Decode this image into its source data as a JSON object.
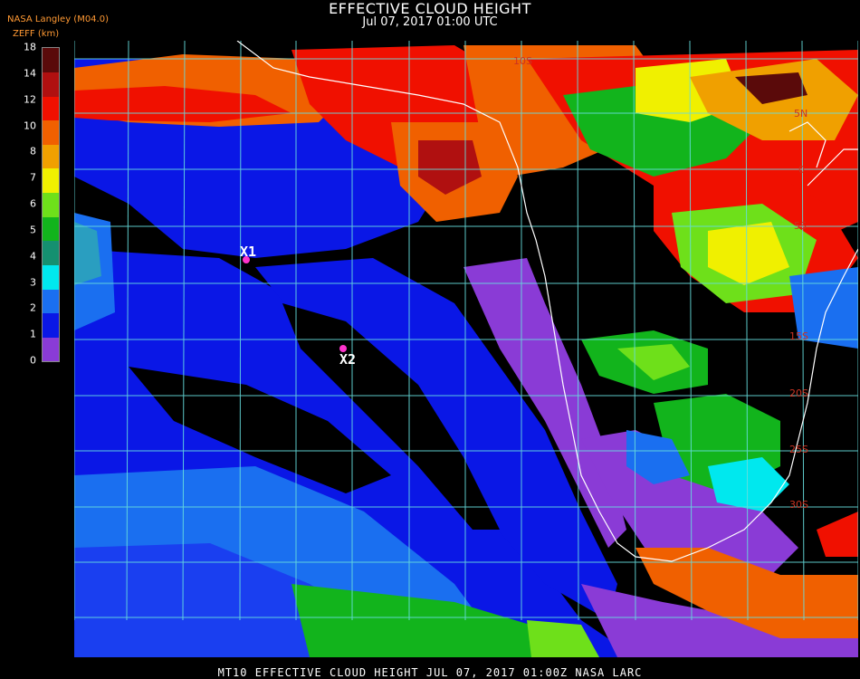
{
  "header": {
    "title": "EFFECTIVE CLOUD HEIGHT",
    "subtitle": "Jul 07, 2017 01:00 UTC",
    "source": "NASA Langley (M04.0)",
    "units": "ZEFF (km)"
  },
  "legend": {
    "ticks": [
      "0",
      "1",
      "2",
      "3",
      "4",
      "5",
      "6",
      "7",
      "8",
      "10",
      "12",
      "14",
      "18"
    ],
    "colors": [
      "#8a3bd6",
      "#0a17e6",
      "#1a6ff0",
      "#00e8ee",
      "#159070",
      "#12b41c",
      "#6ee01a",
      "#f0f000",
      "#f0a000",
      "#f06000",
      "#f01000",
      "#b01010",
      "#5a0a0a"
    ]
  },
  "markers": [
    {
      "label": "X1",
      "color": "#ff33cc"
    },
    {
      "label": "X2",
      "color": "#ff33cc"
    }
  ],
  "lat_labels": [
    "10S",
    "15S",
    "20S",
    "25S",
    "30S",
    "5N",
    "0",
    "5S"
  ],
  "footer": "MT10   EFFECTIVE CLOUD HEIGHT   JUL 07, 2017 01:00Z   NASA LARC"
}
